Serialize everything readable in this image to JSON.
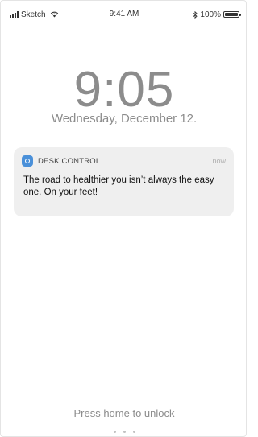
{
  "status_bar": {
    "carrier": "Sketch",
    "time": "9:41 AM",
    "battery": "100%",
    "icons": [
      "signal-icon",
      "wifi-icon",
      "bluetooth-icon",
      "battery-icon"
    ]
  },
  "lock_screen": {
    "time": "9:05",
    "date": "Wednesday, December 12."
  },
  "notification": {
    "app_name": "DESK CONTROL",
    "time": "now",
    "message": "The road to healthier you isn’t always the easy one. On your feet!",
    "icon": "app-icon",
    "accent": "#4a90d9"
  },
  "footer": {
    "unlock_hint": "Press home to unlock",
    "page_count": 3
  }
}
